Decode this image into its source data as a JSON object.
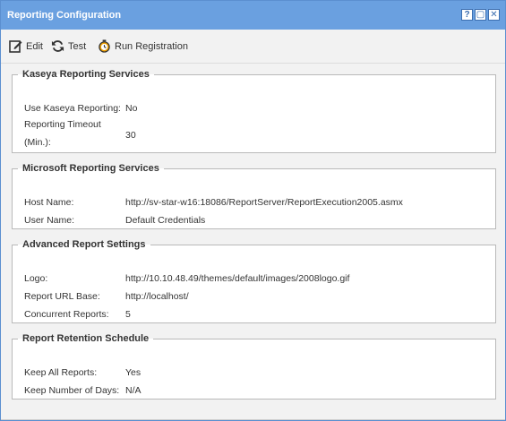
{
  "window": {
    "title": "Reporting Configuration"
  },
  "title_buttons": [
    "?",
    "▢",
    "✕"
  ],
  "toolbar": {
    "edit_label": "Edit",
    "test_label": "Test",
    "run_label": "Run Registration"
  },
  "sections": {
    "kaseya": {
      "title": "Kaseya Reporting Services",
      "use_label": "Use Kaseya Reporting:",
      "use_value": "No",
      "timeout_label_1": "Reporting Timeout",
      "timeout_label_2": "(Min.):",
      "timeout_value": "30"
    },
    "microsoft": {
      "title": "Microsoft Reporting Services",
      "host_label": "Host Name:",
      "host_value": "http://sv-star-w16:18086/ReportServer/ReportExecution2005.asmx",
      "user_label": "User Name:",
      "user_value": "Default Credentials"
    },
    "advanced": {
      "title": "Advanced Report Settings",
      "logo_label": "Logo:",
      "logo_value": "http://10.10.48.49/themes/default/images/2008logo.gif",
      "url_label": "Report URL Base:",
      "url_value": "http://localhost/",
      "concurrent_label": "Concurrent Reports:",
      "concurrent_value": "5"
    },
    "retention": {
      "title": "Report Retention Schedule",
      "keep_all_label": "Keep All Reports:",
      "keep_all_value": "Yes",
      "keep_days_label": "Keep Number of Days:",
      "keep_days_value": "N/A"
    }
  },
  "icons": {
    "edit": "edit-icon",
    "test": "refresh-icon",
    "run": "stopwatch-icon"
  },
  "colors": {
    "titlebar": "#6aa0e0",
    "toolbar": "#f2f2f2",
    "run_icon": "#f0a000"
  }
}
